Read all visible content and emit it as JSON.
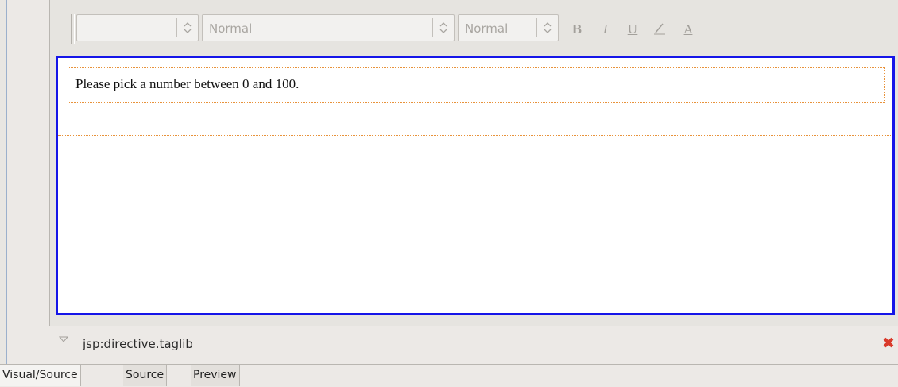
{
  "toolbar": {
    "font_family_value": "",
    "paragraph_style_value": "Normal",
    "font_size_value": "Normal",
    "bold_label": "B",
    "italic_label": "I",
    "underline_label": "U",
    "highlight_label": "/",
    "font_color_label": "A"
  },
  "editor": {
    "paragraph_text": "Please pick a number between 0 and 100."
  },
  "status": {
    "element_path": "jsp:directive.taglib"
  },
  "tabs": [
    {
      "label": "Visual/Source"
    },
    {
      "label": "Source"
    },
    {
      "label": "Preview"
    }
  ],
  "colors": {
    "selection_border": "#1515e8",
    "element_outline": "#e8923a",
    "close_icon": "#d93a2b"
  }
}
